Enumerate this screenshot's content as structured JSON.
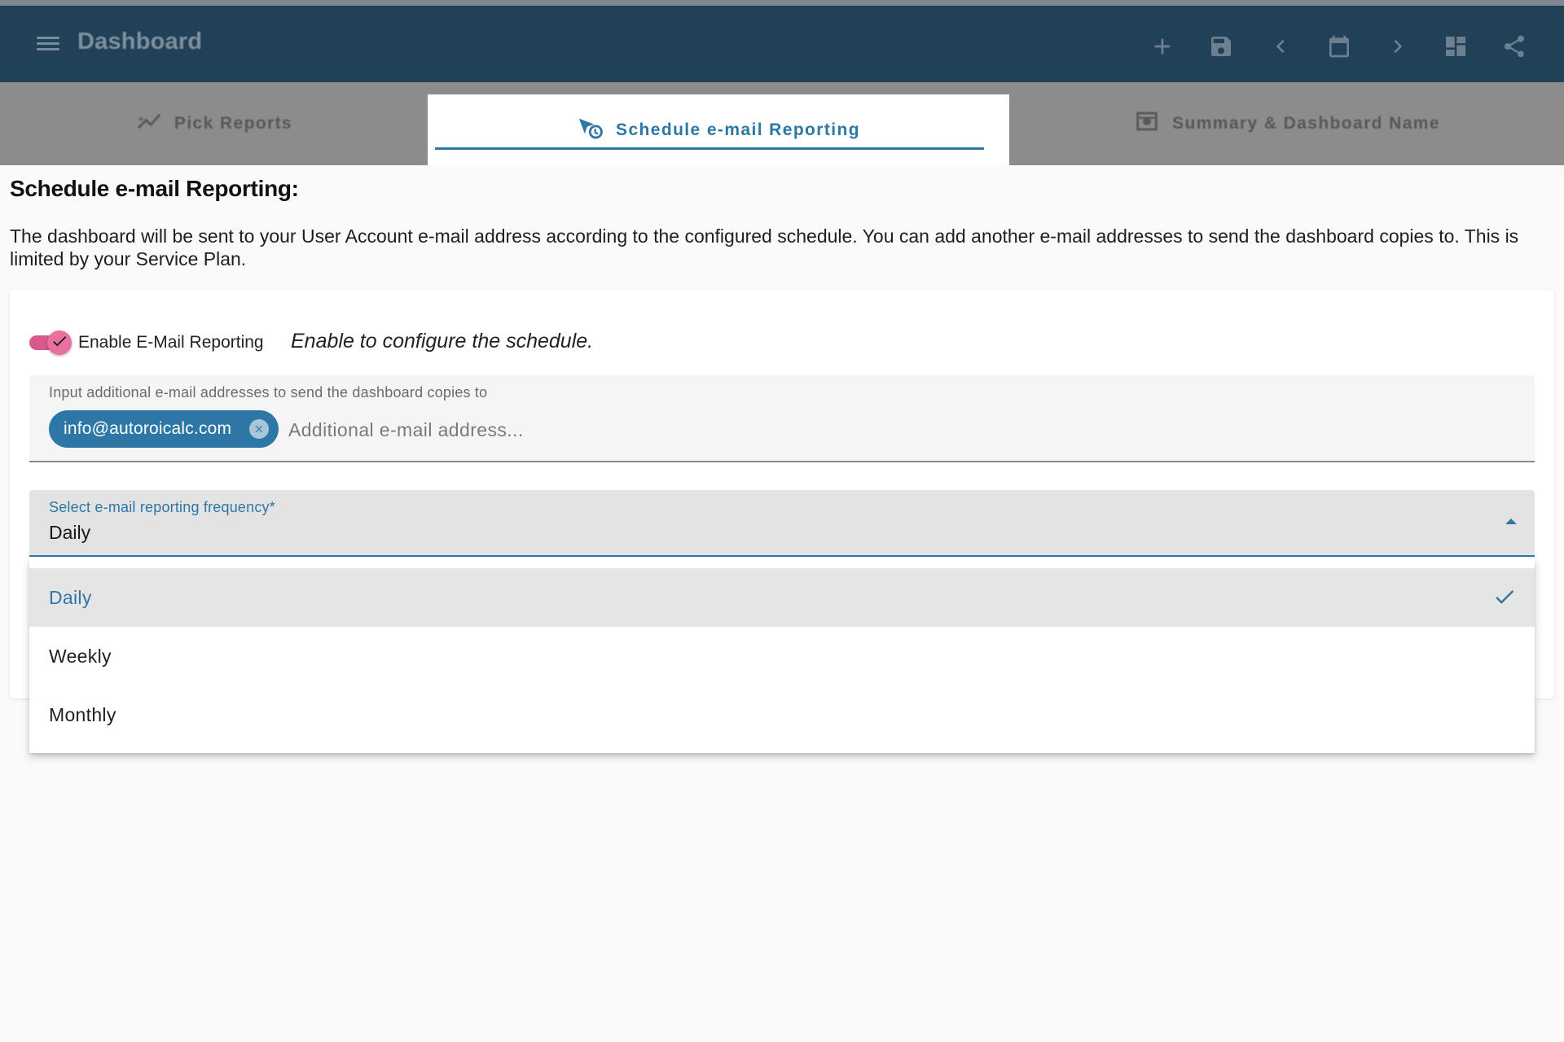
{
  "appbar": {
    "title": "Dashboard",
    "icons": [
      "menu-icon",
      "add-icon",
      "save-icon",
      "chevron-left-icon",
      "calendar-icon",
      "chevron-right-icon",
      "dashboard-grid-icon",
      "share-icon"
    ]
  },
  "tabs": [
    {
      "label": "Pick Reports",
      "icon": "chart-line-icon",
      "active": false
    },
    {
      "label": "Schedule e-mail Reporting",
      "icon": "send-clock-icon",
      "active": true
    },
    {
      "label": "Summary & Dashboard Name",
      "icon": "summary-icon",
      "active": false
    }
  ],
  "content": {
    "title": "Schedule e-mail Reporting:",
    "description": "The dashboard will be sent to your User Account e-mail address according to the configured schedule. You can add another e-mail addresses to send the dashboard copies to. This is limited by your Service Plan."
  },
  "toggle": {
    "label": "Enable E-Mail Reporting",
    "hint": "Enable to configure the schedule.",
    "checked": true
  },
  "emails": {
    "label": "Input additional e-mail addresses to send the dashboard copies to",
    "chips": [
      "info@autoroicalc.com"
    ],
    "placeholder": "Additional e-mail address..."
  },
  "frequency": {
    "label": "Select e-mail reporting frequency*",
    "value": "Daily",
    "options": [
      "Daily",
      "Weekly",
      "Monthly"
    ]
  },
  "colors": {
    "primary": "#2d77a6",
    "appbar": "#214159",
    "toggle": "#e8719f"
  }
}
